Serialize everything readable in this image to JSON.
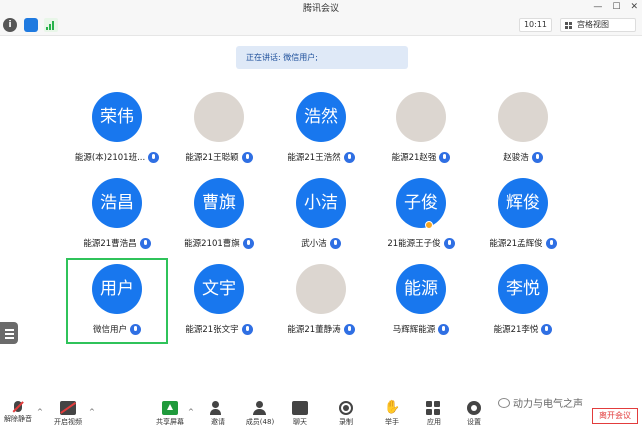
{
  "window": {
    "title": "腾讯会议",
    "controls": [
      "—",
      "☐",
      "✕"
    ]
  },
  "topbar": {
    "timer": "10:11",
    "view_label": "宫格视图"
  },
  "speaking": {
    "text": "正在讲话: 微信用户;"
  },
  "participants": [
    {
      "avatar": "荣伟",
      "name": "能源(本)2101班..."
    },
    {
      "avatar": "",
      "name": "能源21王聪颖"
    },
    {
      "avatar": "浩然",
      "name": "能源21王浩然"
    },
    {
      "avatar": "",
      "name": "能源21赵强"
    },
    {
      "avatar": "",
      "name": "赵骏浩"
    },
    {
      "avatar": "浩昌",
      "name": "能源21曹浩昌"
    },
    {
      "avatar": "曹旗",
      "name": "能源2101曹旗"
    },
    {
      "avatar": "小洁",
      "name": "武小洁"
    },
    {
      "avatar": "子俊",
      "name": "21能源王子俊"
    },
    {
      "avatar": "辉俊",
      "name": "能源21孟辉俊"
    },
    {
      "avatar": "用户",
      "name": "微信用户"
    },
    {
      "avatar": "文宇",
      "name": "能源21张文宇"
    },
    {
      "avatar": "",
      "name": "能源21董静涛"
    },
    {
      "avatar": "能源",
      "name": "马辉辉能源"
    },
    {
      "avatar": "李悦",
      "name": "能源21李悦"
    }
  ],
  "toolbar": {
    "unmute": "解除静音",
    "video": "开启视频",
    "share": "共享屏幕",
    "invite": "邀请",
    "members": "成员(48)",
    "chat": "聊天",
    "record": "录制",
    "raise_hand": "举手",
    "apps": "应用",
    "settings": "设置",
    "leave": "离开会议"
  },
  "watermark": {
    "text": "动力与电气之声"
  },
  "colors": {
    "accent": "#1877ee",
    "active_border": "#2fc35a",
    "leave": "#e23c3c"
  }
}
